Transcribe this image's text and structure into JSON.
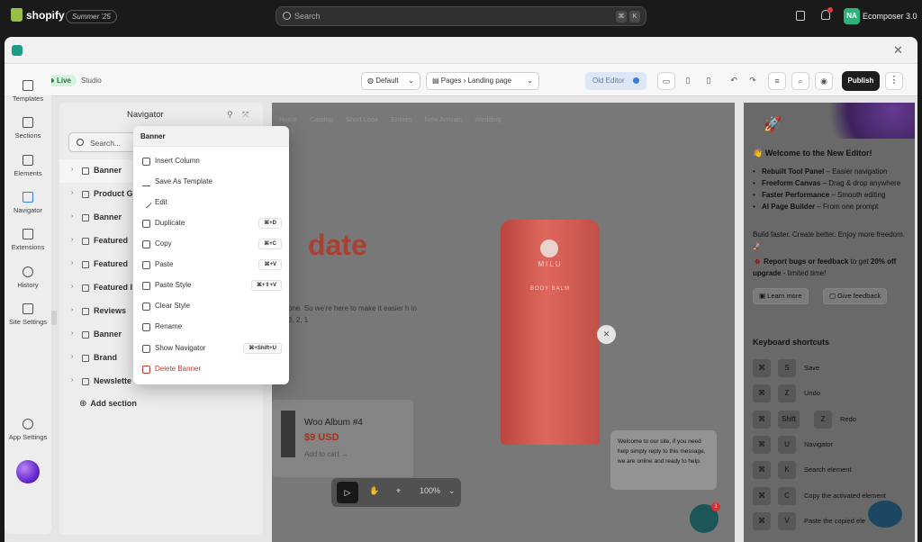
{
  "shopify": {
    "logo_text": "shopify",
    "summer_badge": "Summer '25",
    "search_placeholder": "Search",
    "search_key1": "⌘",
    "search_key2": "K",
    "avatar_initials": "NA",
    "store_name": "Ecomposer 3.0"
  },
  "toolbar": {
    "live_label": "Live",
    "studio_label": "Studio",
    "device_select": "Default",
    "pages_label": "Pages",
    "page_select": "Landing page",
    "old_editor_label": "Old Editor",
    "publish_label": "Publish"
  },
  "rail": {
    "items": [
      {
        "label": "Templates"
      },
      {
        "label": "Sections"
      },
      {
        "label": "Elements"
      },
      {
        "label": "Navigator"
      },
      {
        "label": "Extensions"
      },
      {
        "label": "History"
      },
      {
        "label": "Site Settings"
      }
    ],
    "app_settings": "App Settings"
  },
  "navigator": {
    "title": "Navigator",
    "search_placeholder": "Search...",
    "rows": [
      {
        "label": "Banner"
      },
      {
        "label": "Product G"
      },
      {
        "label": "Banner"
      },
      {
        "label": "Featured"
      },
      {
        "label": "Featured"
      },
      {
        "label": "Featured I"
      },
      {
        "label": "Reviews"
      },
      {
        "label": "Banner"
      },
      {
        "label": "Brand"
      },
      {
        "label": "Newslette"
      }
    ],
    "add_section": "Add section"
  },
  "context_menu": {
    "title": "Banner",
    "items": [
      {
        "label": "Insert Column",
        "shortcut": ""
      },
      {
        "label": "Save As Template",
        "shortcut": ""
      },
      {
        "label": "Edit",
        "shortcut": ""
      },
      {
        "label": "Duplicate",
        "shortcut": "⌘+D"
      },
      {
        "label": "Copy",
        "shortcut": "⌘+C"
      },
      {
        "label": "Paste",
        "shortcut": "⌘+V"
      },
      {
        "label": "Paste Style",
        "shortcut": "⌘+⇧+V"
      },
      {
        "label": "Clear Style",
        "shortcut": ""
      },
      {
        "label": "Rename",
        "shortcut": ""
      },
      {
        "label": "Show Navigator",
        "shortcut": "⌘+Shift+U"
      },
      {
        "label": "Delete Banner",
        "shortcut": ""
      }
    ]
  },
  "canvas": {
    "nav_links": [
      "Home",
      "Catalog",
      "Short Look",
      "Entries",
      "New Arrivals",
      "Wedding"
    ],
    "headline": "date",
    "copy": "one. So we're here to make it easier h in 3, 2, 1",
    "tube_brand": "MILU",
    "tube_sub": "BODY BALM",
    "product_name": "Woo Album #4",
    "product_price": "$9 USD",
    "add_to_cart": "Add to cart →",
    "zoom": "100%",
    "chat_message": "Welcome to our site, if you need help simply reply to this message, we are online and ready to help.",
    "chat_badge": "1"
  },
  "right_panel": {
    "welcome": "👋 Welcome to the New Editor!",
    "features": [
      {
        "bold": "Rebuilt Tool Panel",
        "rest": " – Easier navigation"
      },
      {
        "bold": "Freeform Canvas",
        "rest": " – Drag & drop anywhere"
      },
      {
        "bold": "Faster Performance",
        "rest": " – Smooth editing"
      },
      {
        "bold": "AI Page Builder",
        "rest": " – From one prompt"
      }
    ],
    "build_text": "Build faster. Create better. Enjoy more freedom. 🚀",
    "report_bold": "🐞 Report bugs or feedback",
    "report_mid": " to get ",
    "report_bold2": "20% off upgrade",
    "report_rest": " - limited time!",
    "learn_more": "Learn more",
    "give_feedback": "Give feedback",
    "shortcuts_title": "Keyboard shortcuts",
    "shortcuts": [
      {
        "keys": [
          "⌘",
          "S"
        ],
        "action": "Save"
      },
      {
        "keys": [
          "⌘",
          "Z"
        ],
        "action": "Undo"
      },
      {
        "keys": [
          "⌘",
          "Shift",
          "Z"
        ],
        "action": "Redo"
      },
      {
        "keys": [
          "⌘",
          "U"
        ],
        "action": "Navigator"
      },
      {
        "keys": [
          "⌘",
          "K"
        ],
        "action": "Search element"
      },
      {
        "keys": [
          "⌘",
          "C"
        ],
        "action": "Copy the activated element"
      },
      {
        "keys": [
          "⌘",
          "V"
        ],
        "action": "Paste the copied ele"
      }
    ]
  }
}
